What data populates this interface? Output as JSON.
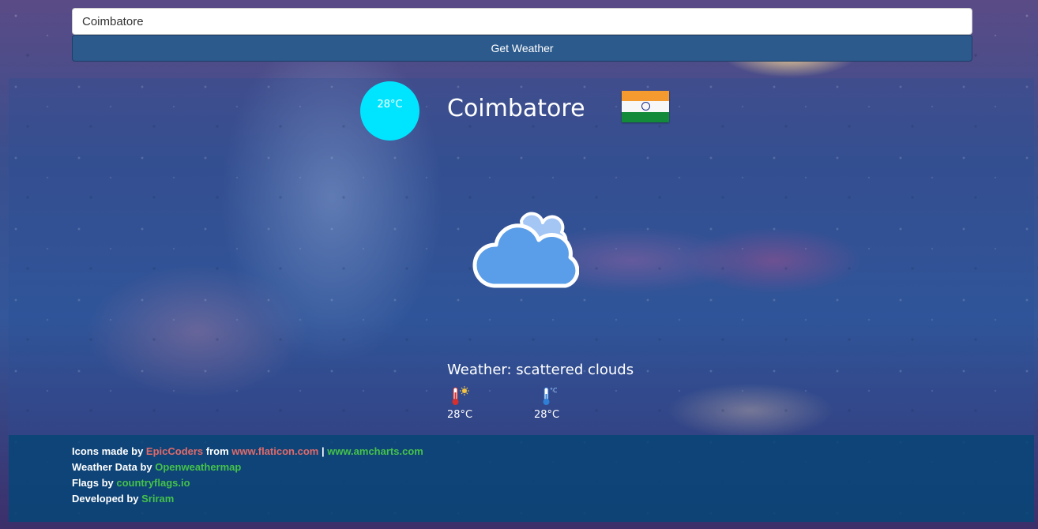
{
  "search": {
    "value": "Coimbatore",
    "button_label": "Get Weather"
  },
  "current": {
    "temp": "28°C",
    "city": "Coimbatore",
    "description": "Weather: scattered clouds",
    "max_temp": "28°C",
    "min_temp": "28°C"
  },
  "icons": {
    "condition": "scattered-clouds-icon",
    "flag": "india-flag",
    "max": "thermometer-hot-icon",
    "min": "thermometer-cold-icon"
  },
  "colors": {
    "temp_circle": "#00e5ff",
    "button": "#2c5a8c",
    "footer": "#084678",
    "link_red": "#e06a6a",
    "link_green": "#45c24a"
  },
  "footer": {
    "line1": {
      "prefix": "Icons made by ",
      "author": "EpicCoders",
      "mid": " from ",
      "site": "www.flaticon.com",
      "sep": " | ",
      "site2": "www.amcharts.com"
    },
    "line2": {
      "prefix": "Weather Data by ",
      "link": "Openweathermap"
    },
    "line3": {
      "prefix": "Flags by ",
      "link": "countryflags.io"
    },
    "line4": {
      "prefix": "Developed by ",
      "link": "Sriram"
    }
  }
}
